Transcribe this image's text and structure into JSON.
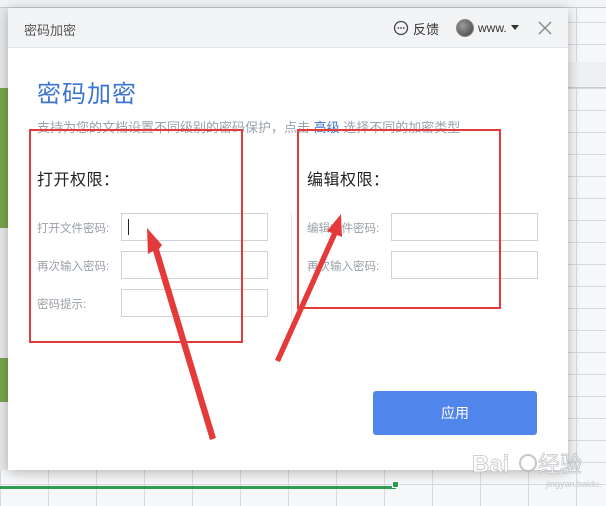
{
  "dialog": {
    "window_title": "密码加密",
    "feedback_label": "反馈",
    "user_name": "www.",
    "heading": "密码加密",
    "subtitle_before": "支持为您的文档设置不同级别的密码保护，点击 ",
    "subtitle_link": "高级",
    "subtitle_after": " 选择不同的加密类型"
  },
  "open_permission": {
    "title": "打开权限：",
    "password_label": "打开文件密码:",
    "password_value": "",
    "confirm_label": "再次输入密码:",
    "confirm_value": "",
    "hint_label": "密码提示:",
    "hint_value": ""
  },
  "edit_permission": {
    "title": "编辑权限：",
    "password_label": "编辑文件密码:",
    "password_value": "",
    "confirm_label": "再次输入密码:",
    "confirm_value": ""
  },
  "apply_label": "应用",
  "colors": {
    "accent": "#3c74cf",
    "button": "#5086eb",
    "annotation": "#e53a3a"
  }
}
